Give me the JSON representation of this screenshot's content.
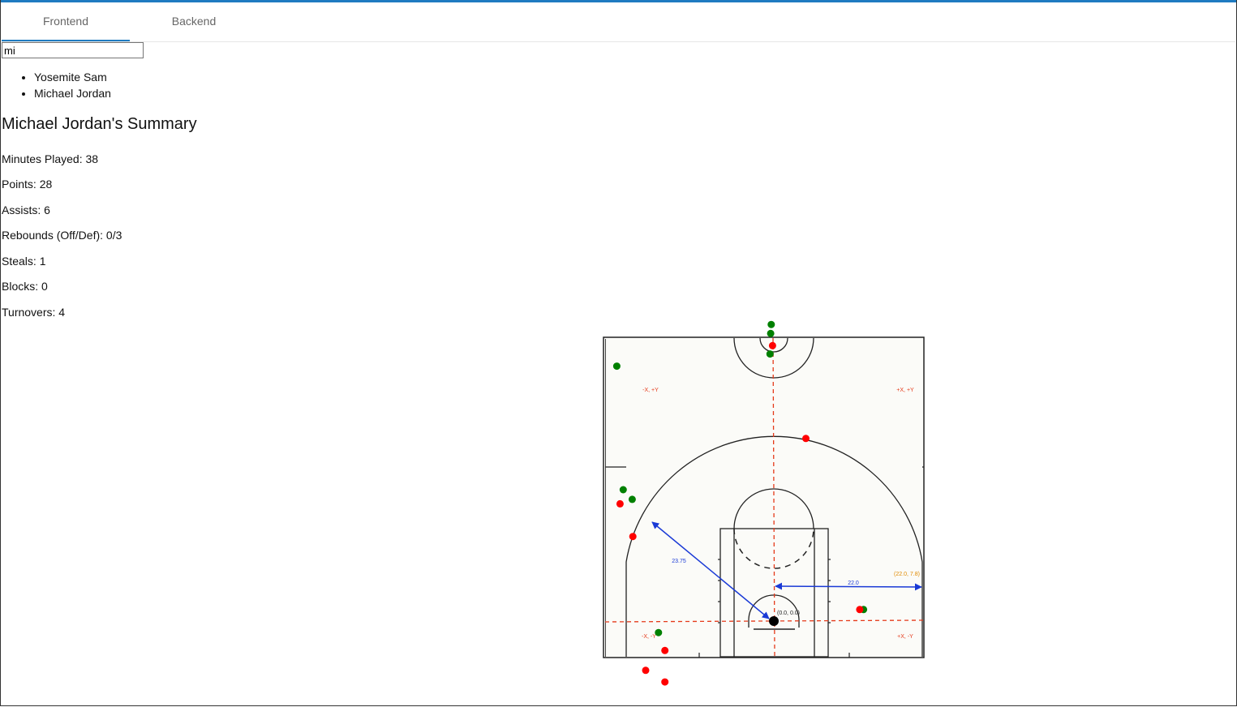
{
  "tabs": [
    {
      "label": "Frontend",
      "active": true
    },
    {
      "label": "Backend",
      "active": false
    }
  ],
  "search": {
    "value": "mi"
  },
  "results": [
    "Yosemite Sam",
    "Michael Jordan"
  ],
  "summary": {
    "title": "Michael Jordan's Summary",
    "stats": [
      "Minutes Played: 38",
      "Points: 28",
      "Assists: 6",
      "Rebounds (Off/Def): 0/3",
      "Steals: 1",
      "Blocks: 0",
      "Turnovers: 4"
    ]
  },
  "chart_data": {
    "type": "scatter",
    "title": "",
    "annotations": {
      "quadrant_labels": [
        "-X, +Y",
        "+X, +Y",
        "-X, -Y",
        "+X, -Y"
      ],
      "origin_label": "(0.0, 0.0)",
      "corner_label": "(22.0, 7.8)",
      "three_point_radius_label": "23.75",
      "corner_three_label": "22.0"
    },
    "xlim": [
      -25,
      25
    ],
    "ylim": [
      -5.5,
      44.5
    ],
    "series": [
      {
        "name": "made",
        "color": "#008000",
        "points": [
          [
            -24.5,
            39.8
          ],
          [
            -23.5,
            20.5
          ],
          [
            -22.1,
            19.0
          ],
          [
            -18.0,
            -1.8
          ],
          [
            14.0,
            1.8
          ],
          [
            -0.4,
            46.3
          ],
          [
            -0.5,
            44.9
          ],
          [
            -0.6,
            41.7
          ]
        ]
      },
      {
        "name": "missed",
        "color": "#ff0000",
        "points": [
          [
            -24.0,
            18.3
          ],
          [
            -22.0,
            13.2
          ],
          [
            -17.0,
            -4.6
          ],
          [
            -20.0,
            -7.7
          ],
          [
            -17.0,
            -9.5
          ],
          [
            5.0,
            28.5
          ],
          [
            13.4,
            1.8
          ],
          [
            -0.2,
            43.0
          ]
        ]
      }
    ],
    "colors": {
      "made": "#008000",
      "missed": "#ff0000",
      "reference_lines": "#e53a1a",
      "measure": "#1a3ad6",
      "corner": "#e08a00"
    }
  }
}
